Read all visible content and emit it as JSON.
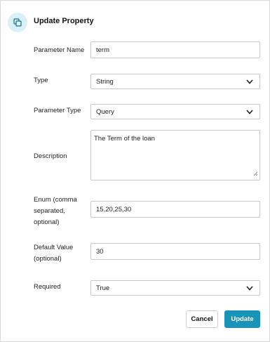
{
  "dialog": {
    "title": "Update Property",
    "header_icon": "copy-icon"
  },
  "form": {
    "parameter_name": {
      "label": "Parameter Name",
      "value": "term"
    },
    "type": {
      "label": "Type",
      "value": "String"
    },
    "parameter_type": {
      "label": "Parameter Type",
      "value": "Query"
    },
    "description": {
      "label": "Description",
      "value": "The Term of the loan"
    },
    "enum": {
      "label_lines": [
        "Enum (comma",
        "separated,",
        "optional)"
      ],
      "value": "15,20,25,30"
    },
    "default_value": {
      "label_lines": [
        "Default Value",
        "(optional)"
      ],
      "value": "30"
    },
    "required": {
      "label": "Required",
      "value": "True"
    }
  },
  "buttons": {
    "cancel_label": "Cancel",
    "update_label": "Update"
  },
  "colors": {
    "accent": "#1a93b8",
    "icon_bg": "#d8f1f8"
  }
}
